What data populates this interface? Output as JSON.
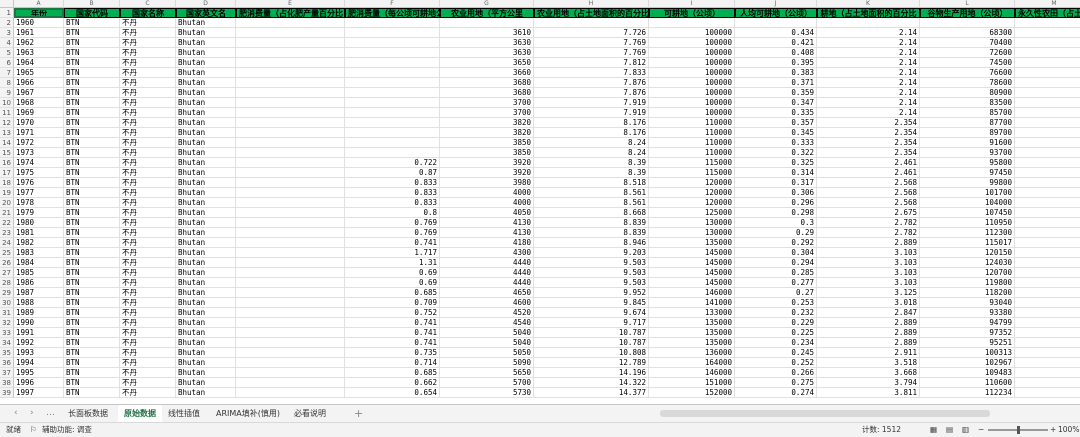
{
  "columns": [
    "A",
    "B",
    "C",
    "D",
    "E",
    "F",
    "G",
    "H",
    "I",
    "J",
    "K",
    "L",
    "M"
  ],
  "headers": [
    "年份",
    "国家代码",
    "国家名称",
    "国家英文名",
    "肥消费量（占化肥产量百分比",
    "肥消费量（每公顷可耕地公斤",
    "农业用地（平方公里",
    "农业用地（占土地面积的百分比",
    "可耕地（公顷）",
    "人均可耕地（公顷）",
    "耕地（占土地面积的百分比",
    "谷物生产用地（公顷）",
    "永久性农田（占土地面积"
  ],
  "rows": [
    [
      "1960",
      "BTN",
      "不丹",
      "Bhutan",
      "",
      "",
      "",
      "",
      "",
      "",
      "",
      "",
      ""
    ],
    [
      "1961",
      "BTN",
      "不丹",
      "Bhutan",
      "",
      "",
      "3610",
      "7.726",
      "100000",
      "0.434",
      "2.14",
      "68300",
      ""
    ],
    [
      "1962",
      "BTN",
      "不丹",
      "Bhutan",
      "",
      "",
      "3630",
      "7.769",
      "100000",
      "0.421",
      "2.14",
      "70400",
      ""
    ],
    [
      "1963",
      "BTN",
      "不丹",
      "Bhutan",
      "",
      "",
      "3630",
      "7.769",
      "100000",
      "0.408",
      "2.14",
      "72600",
      ""
    ],
    [
      "1964",
      "BTN",
      "不丹",
      "Bhutan",
      "",
      "",
      "3650",
      "7.812",
      "100000",
      "0.395",
      "2.14",
      "74500",
      ""
    ],
    [
      "1965",
      "BTN",
      "不丹",
      "Bhutan",
      "",
      "",
      "3660",
      "7.833",
      "100000",
      "0.383",
      "2.14",
      "76600",
      ""
    ],
    [
      "1966",
      "BTN",
      "不丹",
      "Bhutan",
      "",
      "",
      "3680",
      "7.876",
      "100000",
      "0.371",
      "2.14",
      "78600",
      ""
    ],
    [
      "1967",
      "BTN",
      "不丹",
      "Bhutan",
      "",
      "",
      "3680",
      "7.876",
      "100000",
      "0.359",
      "2.14",
      "80900",
      ""
    ],
    [
      "1968",
      "BTN",
      "不丹",
      "Bhutan",
      "",
      "",
      "3700",
      "7.919",
      "100000",
      "0.347",
      "2.14",
      "83500",
      ""
    ],
    [
      "1969",
      "BTN",
      "不丹",
      "Bhutan",
      "",
      "",
      "3700",
      "7.919",
      "100000",
      "0.335",
      "2.14",
      "85700",
      ""
    ],
    [
      "1970",
      "BTN",
      "不丹",
      "Bhutan",
      "",
      "",
      "3820",
      "8.176",
      "110000",
      "0.357",
      "2.354",
      "87700",
      ""
    ],
    [
      "1971",
      "BTN",
      "不丹",
      "Bhutan",
      "",
      "",
      "3820",
      "8.176",
      "110000",
      "0.345",
      "2.354",
      "89700",
      ""
    ],
    [
      "1972",
      "BTN",
      "不丹",
      "Bhutan",
      "",
      "",
      "3850",
      "8.24",
      "110000",
      "0.333",
      "2.354",
      "91600",
      ""
    ],
    [
      "1973",
      "BTN",
      "不丹",
      "Bhutan",
      "",
      "",
      "3850",
      "8.24",
      "110000",
      "0.322",
      "2.354",
      "93700",
      ""
    ],
    [
      "1974",
      "BTN",
      "不丹",
      "Bhutan",
      "",
      "0.722",
      "3920",
      "8.39",
      "115000",
      "0.325",
      "2.461",
      "95800",
      ""
    ],
    [
      "1975",
      "BTN",
      "不丹",
      "Bhutan",
      "",
      "0.87",
      "3920",
      "8.39",
      "115000",
      "0.314",
      "2.461",
      "97450",
      ""
    ],
    [
      "1976",
      "BTN",
      "不丹",
      "Bhutan",
      "",
      "0.833",
      "3980",
      "8.518",
      "120000",
      "0.317",
      "2.568",
      "99800",
      ""
    ],
    [
      "1977",
      "BTN",
      "不丹",
      "Bhutan",
      "",
      "0.833",
      "4000",
      "8.561",
      "120000",
      "0.306",
      "2.568",
      "101700",
      ""
    ],
    [
      "1978",
      "BTN",
      "不丹",
      "Bhutan",
      "",
      "0.833",
      "4000",
      "8.561",
      "120000",
      "0.296",
      "2.568",
      "104000",
      ""
    ],
    [
      "1979",
      "BTN",
      "不丹",
      "Bhutan",
      "",
      "0.8",
      "4050",
      "8.668",
      "125000",
      "0.298",
      "2.675",
      "107450",
      ""
    ],
    [
      "1980",
      "BTN",
      "不丹",
      "Bhutan",
      "",
      "0.769",
      "4130",
      "8.839",
      "130000",
      "0.3",
      "2.782",
      "110950",
      ""
    ],
    [
      "1981",
      "BTN",
      "不丹",
      "Bhutan",
      "",
      "0.769",
      "4130",
      "8.839",
      "130000",
      "0.29",
      "2.782",
      "112300",
      ""
    ],
    [
      "1982",
      "BTN",
      "不丹",
      "Bhutan",
      "",
      "0.741",
      "4180",
      "8.946",
      "135000",
      "0.292",
      "2.889",
      "115017",
      ""
    ],
    [
      "1983",
      "BTN",
      "不丹",
      "Bhutan",
      "",
      "1.717",
      "4300",
      "9.203",
      "145000",
      "0.304",
      "3.103",
      "120150",
      ""
    ],
    [
      "1984",
      "BTN",
      "不丹",
      "Bhutan",
      "",
      "1.31",
      "4440",
      "9.503",
      "145000",
      "0.294",
      "3.103",
      "124030",
      ""
    ],
    [
      "1985",
      "BTN",
      "不丹",
      "Bhutan",
      "",
      "0.69",
      "4440",
      "9.503",
      "145000",
      "0.285",
      "3.103",
      "120700",
      ""
    ],
    [
      "1986",
      "BTN",
      "不丹",
      "Bhutan",
      "",
      "0.69",
      "4440",
      "9.503",
      "145000",
      "0.277",
      "3.103",
      "119800",
      ""
    ],
    [
      "1987",
      "BTN",
      "不丹",
      "Bhutan",
      "",
      "0.685",
      "4650",
      "9.952",
      "146000",
      "0.27",
      "3.125",
      "118200",
      ""
    ],
    [
      "1988",
      "BTN",
      "不丹",
      "Bhutan",
      "",
      "0.709",
      "4600",
      "9.845",
      "141000",
      "0.253",
      "3.018",
      "93040",
      ""
    ],
    [
      "1989",
      "BTN",
      "不丹",
      "Bhutan",
      "",
      "0.752",
      "4520",
      "9.674",
      "133000",
      "0.232",
      "2.847",
      "93380",
      ""
    ],
    [
      "1990",
      "BTN",
      "不丹",
      "Bhutan",
      "",
      "0.741",
      "4540",
      "9.717",
      "135000",
      "0.229",
      "2.889",
      "94799",
      ""
    ],
    [
      "1991",
      "BTN",
      "不丹",
      "Bhutan",
      "",
      "0.741",
      "5040",
      "10.787",
      "135000",
      "0.225",
      "2.889",
      "97352",
      ""
    ],
    [
      "1992",
      "BTN",
      "不丹",
      "Bhutan",
      "",
      "0.741",
      "5040",
      "10.787",
      "135000",
      "0.234",
      "2.889",
      "95251",
      ""
    ],
    [
      "1993",
      "BTN",
      "不丹",
      "Bhutan",
      "",
      "0.735",
      "5050",
      "10.808",
      "136000",
      "0.245",
      "2.911",
      "100313",
      ""
    ],
    [
      "1994",
      "BTN",
      "不丹",
      "Bhutan",
      "",
      "0.714",
      "5090",
      "12.789",
      "164000",
      "0.252",
      "3.518",
      "102967",
      ""
    ],
    [
      "1995",
      "BTN",
      "不丹",
      "Bhutan",
      "",
      "0.685",
      "5650",
      "14.196",
      "146000",
      "0.266",
      "3.668",
      "109483",
      ""
    ],
    [
      "1996",
      "BTN",
      "不丹",
      "Bhutan",
      "",
      "0.662",
      "5700",
      "14.322",
      "151000",
      "0.275",
      "3.794",
      "110600",
      ""
    ],
    [
      "1997",
      "BTN",
      "不丹",
      "Bhutan",
      "",
      "0.654",
      "5730",
      "14.377",
      "152000",
      "0.274",
      "3.811",
      "112234",
      ""
    ]
  ],
  "tabs": [
    "长面板数据",
    "原始数据",
    "线性插值",
    "ARIMA填补(慎用)",
    "必看说明"
  ],
  "active_tab": 1,
  "add_tab_label": "+",
  "status": {
    "ready": "就绪",
    "accessibility": "辅助功能: 调查",
    "count": "计数: 1512",
    "zoom": "100%"
  }
}
